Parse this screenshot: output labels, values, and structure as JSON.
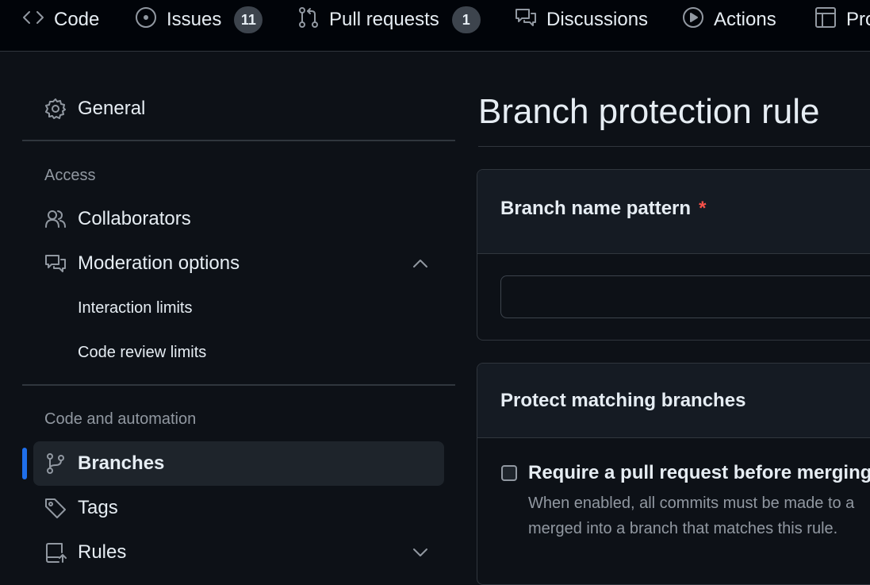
{
  "repo_nav": {
    "tabs": [
      {
        "label": "Code",
        "icon": "code-icon"
      },
      {
        "label": "Issues",
        "icon": "issue-opened-icon",
        "count": "11"
      },
      {
        "label": "Pull requests",
        "icon": "git-pull-request-icon",
        "count": "1"
      },
      {
        "label": "Discussions",
        "icon": "comment-discussion-icon"
      },
      {
        "label": "Actions",
        "icon": "play-icon"
      },
      {
        "label": "Pro",
        "icon": "table-icon"
      }
    ]
  },
  "sidebar": {
    "general": {
      "label": "General",
      "icon": "gear-icon"
    },
    "access_heading": "Access",
    "collaborators": {
      "label": "Collaborators",
      "icon": "people-icon"
    },
    "moderation": {
      "label": "Moderation options",
      "icon": "report-icon",
      "expanded": true
    },
    "interaction_limits": "Interaction limits",
    "code_review_limits": "Code review limits",
    "automation_heading": "Code and automation",
    "branches": {
      "label": "Branches",
      "icon": "git-branch-icon",
      "active": true
    },
    "tags": {
      "label": "Tags",
      "icon": "tag-icon"
    },
    "rules": {
      "label": "Rules",
      "icon": "repo-push-icon",
      "expanded": false
    }
  },
  "main": {
    "title": "Branch protection rule",
    "branch_pattern": {
      "label": "Branch name pattern",
      "required_mark": "*",
      "value": ""
    },
    "protect": {
      "heading": "Protect matching branches",
      "require_pr": {
        "title": "Require a pull request before merging",
        "description": "When enabled, all commits must be made to a merged into a branch that matches this rule.",
        "checked": false
      }
    }
  },
  "colors": {
    "page_bg": "#0d1117",
    "nav_bg": "#010409",
    "border": "#30363d",
    "accent": "#1f6feb",
    "required": "#f85149",
    "muted_text": "#9198a1"
  }
}
